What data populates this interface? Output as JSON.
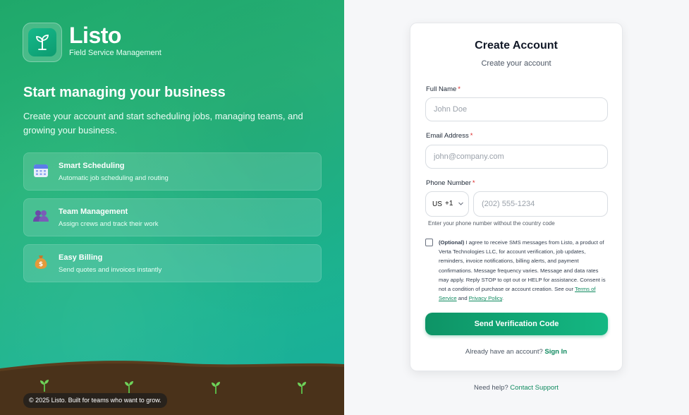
{
  "brand": {
    "name": "Listo",
    "tagline": "Field Service Management",
    "icon": "sprout-icon"
  },
  "hero": {
    "headline": "Start managing your business",
    "subheadline": "Create your account and start scheduling jobs, managing teams, and growing your business."
  },
  "features": [
    {
      "icon": "calendar-icon",
      "title": "Smart Scheduling",
      "description": "Automatic job scheduling and routing"
    },
    {
      "icon": "team-icon",
      "title": "Team Management",
      "description": "Assign crews and track their work"
    },
    {
      "icon": "money-bag-icon",
      "title": "Easy Billing",
      "description": "Send quotes and invoices instantly"
    }
  ],
  "footer_left": {
    "copyright": "© 2025 Listo. Built for teams who want to grow."
  },
  "form": {
    "title": "Create Account",
    "subtitle": "Create your account",
    "full_name": {
      "label": "Full Name",
      "required": "*",
      "placeholder": "John Doe"
    },
    "email": {
      "label": "Email Address",
      "required": "*",
      "placeholder": "john@company.com"
    },
    "phone": {
      "label": "Phone Number",
      "required": "*",
      "country_code": "US",
      "dial_code": "+1",
      "placeholder": "(202) 555-1234",
      "hint": "Enter your phone number without the country code"
    },
    "consent": {
      "optional_label": "(Optional)",
      "text": "I agree to receive SMS messages from Listo, a product of Verta Technologies LLC, for account verification, job updates, reminders, invoice notifications, billing alerts, and payment confirmations. Message frequency varies. Message and data rates may apply. Reply STOP to opt out or HELP for assistance. Consent is not a condition of purchase or account creation. See our",
      "terms_link": "Terms of Service",
      "and": "and",
      "privacy_link": "Privacy Policy",
      "end": ".",
      "checked": false
    },
    "submit_label": "Send Verification Code",
    "signin_prompt": "Already have an account?",
    "signin_link": "Sign In"
  },
  "help": {
    "prompt": "Need help?",
    "link": "Contact Support"
  },
  "colors": {
    "accent": "#10a070",
    "link": "#0f8a5f",
    "required": "#dc2626"
  }
}
